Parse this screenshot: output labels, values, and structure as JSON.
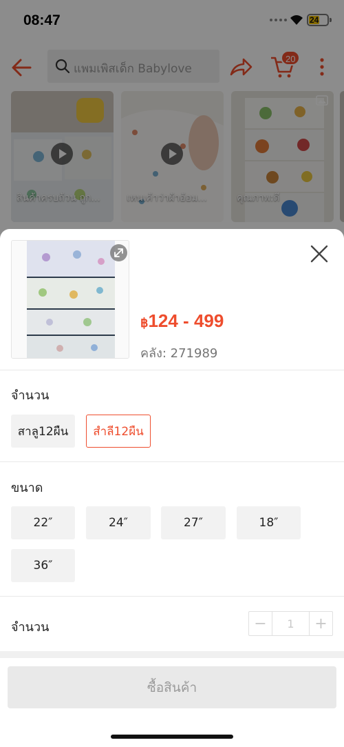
{
  "status_bar": {
    "time": "08:47",
    "battery": "24"
  },
  "header": {
    "search_placeholder": "แพมเพิสเด็ก Babylove",
    "cart_count": "20"
  },
  "thumbnails": [
    {
      "caption": "สินค้าครบถ้วน ถูก...",
      "has_video": true
    },
    {
      "caption": "เหนเค้าว่าผ้าอ้อม...",
      "has_video": true
    },
    {
      "caption": "คุณภาพ:ดี",
      "has_video": false
    }
  ],
  "sheet": {
    "price": "124 - 499",
    "currency": "฿",
    "stock": "คลัง: 271989",
    "variation_title": "จำนวน",
    "variations": [
      {
        "label": "สาลู12ผืน",
        "selected": false
      },
      {
        "label": "สำลี12ผืน",
        "selected": true
      }
    ],
    "size_title": "ขนาด",
    "sizes": [
      "22″",
      "24″",
      "27″",
      "18″",
      "36″"
    ],
    "quantity_title": "จำนวน",
    "quantity": "1",
    "minus": "−",
    "plus": "+",
    "buy_label": "ซื้อสินค้า"
  },
  "colors": {
    "accent": "#ee4d2d",
    "disabled_bg": "#e9e9e9",
    "option_bg": "#f2f2f2"
  }
}
